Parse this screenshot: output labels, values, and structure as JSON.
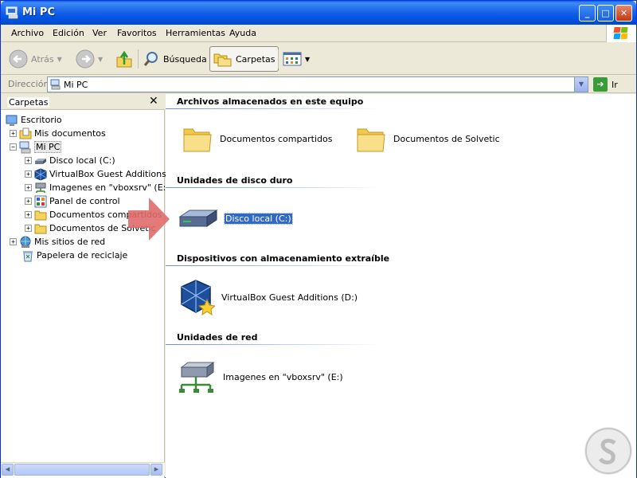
{
  "window": {
    "title": "Mi PC",
    "controls": {
      "minimize": "_",
      "maximize": "□",
      "close": "✕"
    }
  },
  "menu": [
    "Archivo",
    "Edición",
    "Ver",
    "Favoritos",
    "Herramientas",
    "Ayuda"
  ],
  "toolbar": {
    "back": "Atrás",
    "search": "Búsqueda",
    "folders": "Carpetas"
  },
  "address": {
    "label": "Dirección",
    "value": "Mi PC",
    "go": "Ir"
  },
  "left_pane": {
    "title": "Carpetas",
    "close": "✕",
    "tree": [
      {
        "label": "Escritorio",
        "depth": 0,
        "expander": "",
        "icon": "desktop-icon"
      },
      {
        "label": "Mis documentos",
        "depth": 1,
        "expander": "+",
        "icon": "my-documents-icon"
      },
      {
        "label": "Mi PC",
        "depth": 1,
        "expander": "−",
        "icon": "my-computer-icon",
        "selected": true
      },
      {
        "label": "Disco local (C:)",
        "depth": 2,
        "expander": "+",
        "icon": "hard-drive-icon"
      },
      {
        "label": "VirtualBox Guest Additions (D",
        "depth": 2,
        "expander": "+",
        "icon": "virtualbox-cd-icon"
      },
      {
        "label": "Imagenes en \"vboxsrv\" (E:)",
        "depth": 2,
        "expander": "+",
        "icon": "network-drive-icon"
      },
      {
        "label": "Panel de control",
        "depth": 2,
        "expander": "+",
        "icon": "control-panel-icon"
      },
      {
        "label": "Documentos compartidos",
        "depth": 2,
        "expander": "+",
        "icon": "folder-icon"
      },
      {
        "label": "Documentos de Solvetic",
        "depth": 2,
        "expander": "+",
        "icon": "folder-icon"
      },
      {
        "label": "Mis sitios de red",
        "depth": 1,
        "expander": "+",
        "icon": "network-places-icon"
      },
      {
        "label": "Papelera de reciclaje",
        "depth": 1,
        "expander": "",
        "icon": "recycle-bin-icon"
      }
    ]
  },
  "groups": {
    "stored_files": {
      "title": "Archivos almacenados en este equipo",
      "items": [
        "Documentos compartidos",
        "Documentos de Solvetic"
      ]
    },
    "hard_drives": {
      "title": "Unidades de disco duro",
      "items": [
        "Disco local (C:)"
      ]
    },
    "removable": {
      "title": "Dispositivos con almacenamiento extraíble",
      "items": [
        "VirtualBox Guest Additions (D:)"
      ]
    },
    "network": {
      "title": "Unidades de red",
      "items": [
        "Imagenes en \"vboxsrv\" (E:)"
      ]
    }
  },
  "colors": {
    "selection": "#316ac5",
    "arrow": "#e06b6b",
    "title_bar": "#0055e5"
  }
}
